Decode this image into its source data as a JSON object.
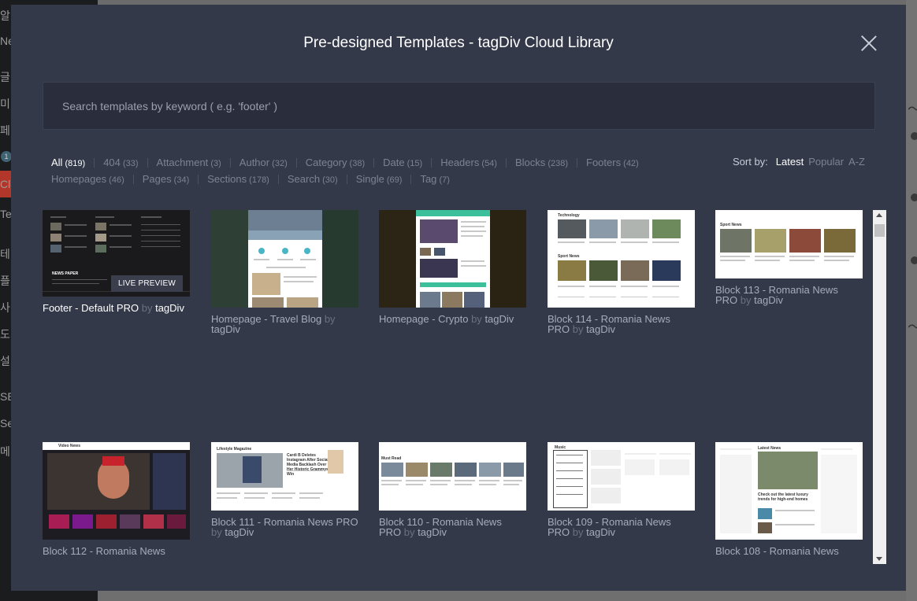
{
  "background": {
    "sidebar_items": [
      "알",
      "Ne",
      "글",
      "미",
      "페",
      "Cl",
      "Ten",
      "테",
      "플",
      "사",
      "도",
      "설",
      "SE",
      "Se",
      "메"
    ],
    "badge": "1"
  },
  "modal": {
    "title": "Pre-designed Templates - tagDiv Cloud Library",
    "search_placeholder": "Search templates by keyword ( e.g. 'footer' )",
    "filters_row1": [
      {
        "label": "All",
        "count": "(819)",
        "active": true
      },
      {
        "label": "404",
        "count": "(33)"
      },
      {
        "label": "Attachment",
        "count": "(3)"
      },
      {
        "label": "Author",
        "count": "(32)"
      },
      {
        "label": "Category",
        "count": "(38)"
      },
      {
        "label": "Date",
        "count": "(15)"
      },
      {
        "label": "Headers",
        "count": "(54)"
      },
      {
        "label": "Blocks",
        "count": "(238)"
      },
      {
        "label": "Footers",
        "count": "(42)"
      }
    ],
    "filters_row2": [
      {
        "label": "Homepages",
        "count": "(46)"
      },
      {
        "label": "Pages",
        "count": "(34)"
      },
      {
        "label": "Sections",
        "count": "(178)"
      },
      {
        "label": "Search",
        "count": "(30)"
      },
      {
        "label": "Single",
        "count": "(69)"
      },
      {
        "label": "Tag",
        "count": "(7)"
      }
    ],
    "sort": {
      "label": "Sort by:",
      "options": [
        "Latest",
        "Popular",
        "A-Z"
      ],
      "active": "Latest"
    },
    "live_preview_label": "LIVE PREVIEW",
    "by_label": "by",
    "templates": [
      {
        "name": "Footer - Default PRO",
        "author": "tagDiv"
      },
      {
        "name": "Homepage - Travel Blog",
        "author": "tagDiv"
      },
      {
        "name": "Homepage - Crypto",
        "author": "tagDiv"
      },
      {
        "name": "Block 114 - Romania News PRO",
        "author": "tagDiv"
      },
      {
        "name": "Block 113 - Romania News PRO",
        "author": "tagDiv"
      },
      {
        "name": "Block 112 - Romania News",
        "author": ""
      },
      {
        "name": "Block 111 - Romania News PRO",
        "author": "tagDiv"
      },
      {
        "name": "Block 110 - Romania News PRO",
        "author": "tagDiv"
      },
      {
        "name": "Block 109 - Romania News PRO",
        "author": "tagDiv"
      },
      {
        "name": "Block 108 - Romania News",
        "author": ""
      }
    ],
    "thumb_labels": {
      "t0_logo": "NEWS PAPER",
      "t3_head": "Technology",
      "t3_sub": "Sport News",
      "t4_head": "Sport News",
      "t5_head": "Video News",
      "t6_head": "Lifestyle Magazine",
      "t6_story": "Cardi B Deletes Instagram After Social Media Backlash Over Her Historic Grammys Win",
      "t7_head": "Must Read",
      "t8_head": "Music",
      "t9_head": "Latest News",
      "t9_story": "Check out the latest luxury trends for high-end homes"
    }
  },
  "colors": {
    "modal_bg": "#34394a",
    "search_bg": "#2a2e3c",
    "active_text": "#ffffff",
    "muted_text": "#7d8293"
  }
}
